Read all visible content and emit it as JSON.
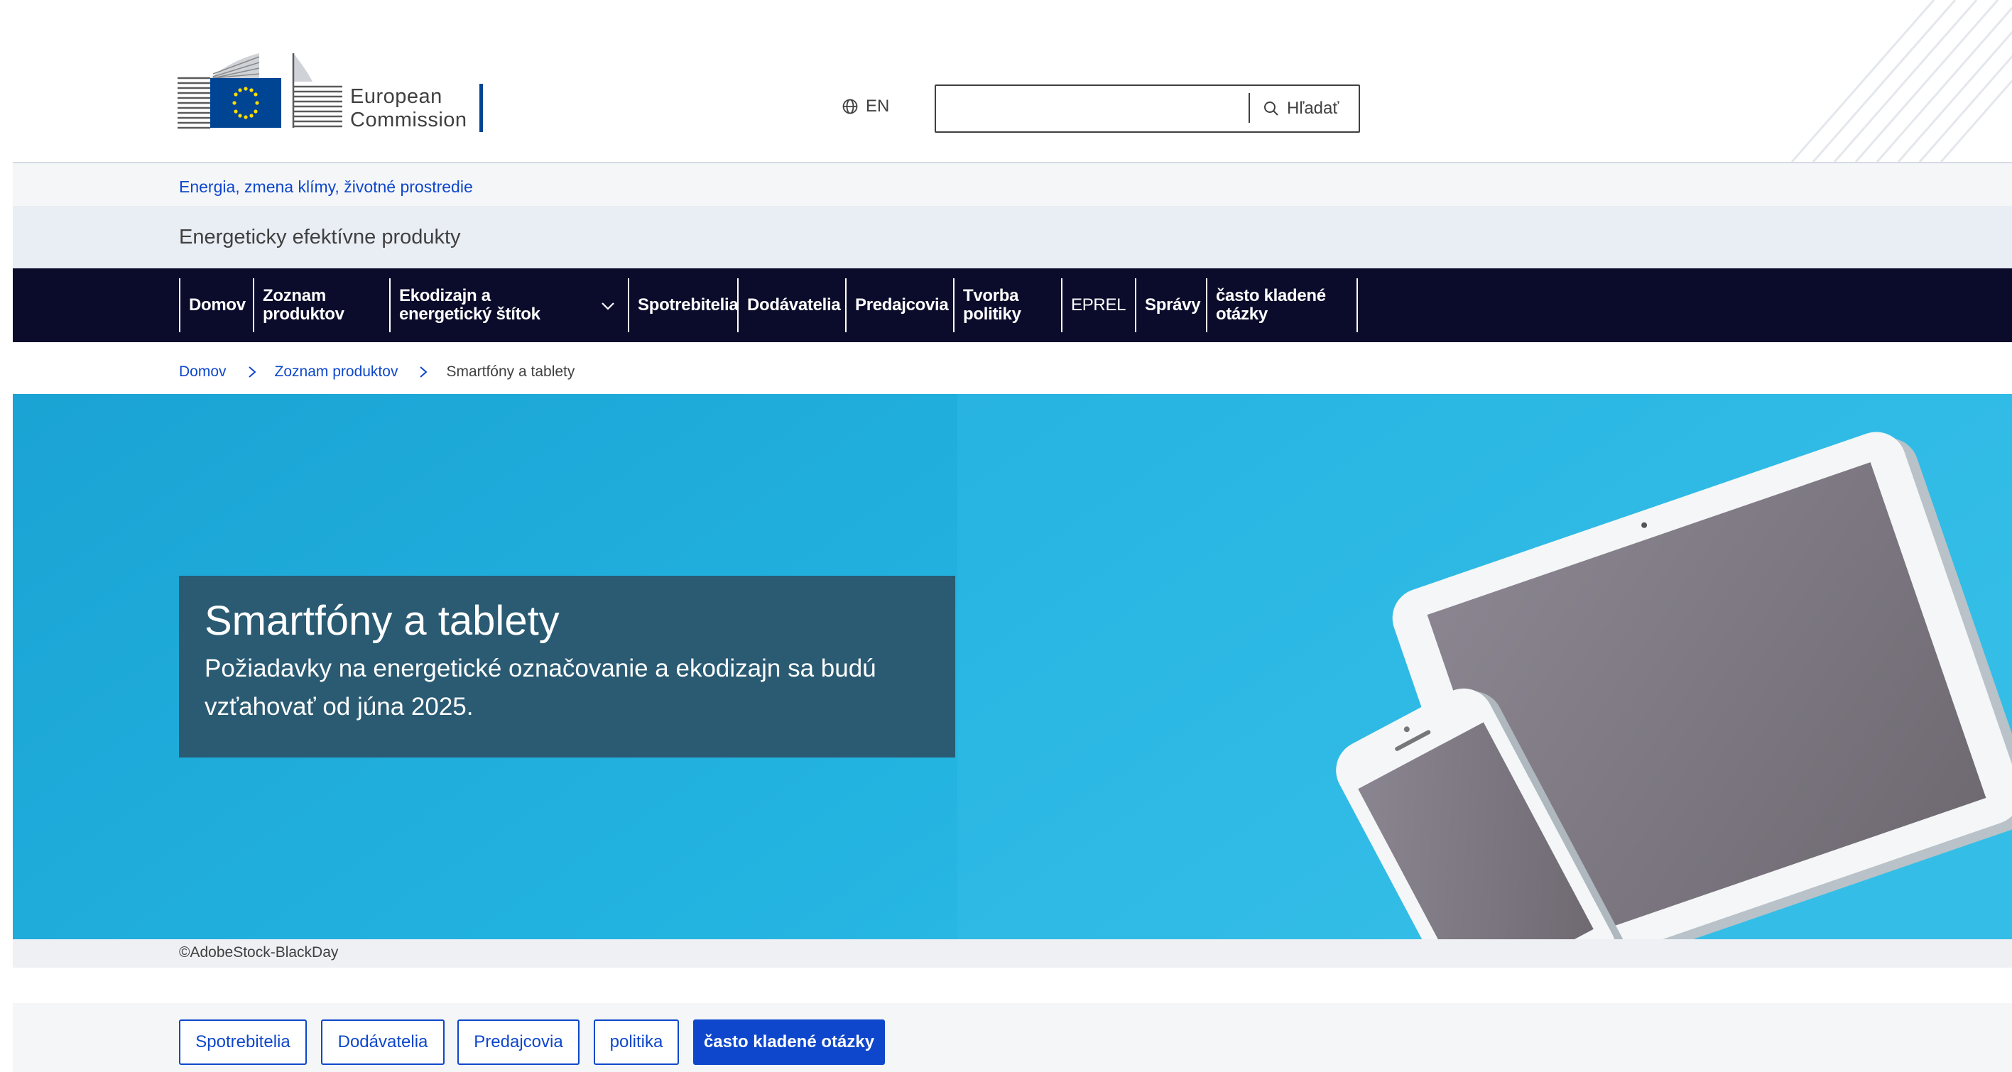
{
  "header": {
    "logo_line1": "European",
    "logo_line2": "Commission",
    "language": "EN",
    "search_placeholder": "",
    "search_button_label": "Hľadať"
  },
  "site": {
    "dg_link": "Energia, zmena klímy, životné prostredie",
    "site_name": "Energeticky efektívne produkty"
  },
  "nav": {
    "items": [
      {
        "label": "Domov"
      },
      {
        "label": "Zoznam produktov"
      },
      {
        "label": "Ekodizajn a energetický štítok"
      },
      {
        "label": "Spotrebitelia"
      },
      {
        "label": "Dodávatelia"
      },
      {
        "label": "Predajcovia"
      },
      {
        "label": "Tvorba politiky"
      },
      {
        "label": "EPREL"
      },
      {
        "label": "Správy"
      },
      {
        "label": "často kladené otázky"
      }
    ]
  },
  "breadcrumb": {
    "items": [
      "Domov",
      "Zoznam produktov"
    ],
    "current": "Smartfóny a tablety"
  },
  "hero": {
    "title": "Smartfóny a tablety",
    "text": "Požiadavky na energetické označovanie a ekodizajn sa budú vzťahovať od júna 2025.",
    "caption": "©AdobeStock-BlackDay"
  },
  "quick_links": [
    {
      "label": "Spotrebitelia"
    },
    {
      "label": "Dodávatelia"
    },
    {
      "label": "Predajcovia"
    },
    {
      "label": "politika"
    },
    {
      "label": "často kladené otázky"
    }
  ],
  "colors": {
    "nav_background": "#0b0c2b",
    "link_blue": "#0e47cb",
    "hero_background": "#1ea7d6",
    "hero_box": "#2a5b73",
    "logo_blue": "#004494"
  },
  "icons": {
    "language": "globe-icon",
    "search": "search-icon",
    "dropdown": "chevron-down-icon",
    "breadcrumb_separator": "chevron-right-icon"
  }
}
